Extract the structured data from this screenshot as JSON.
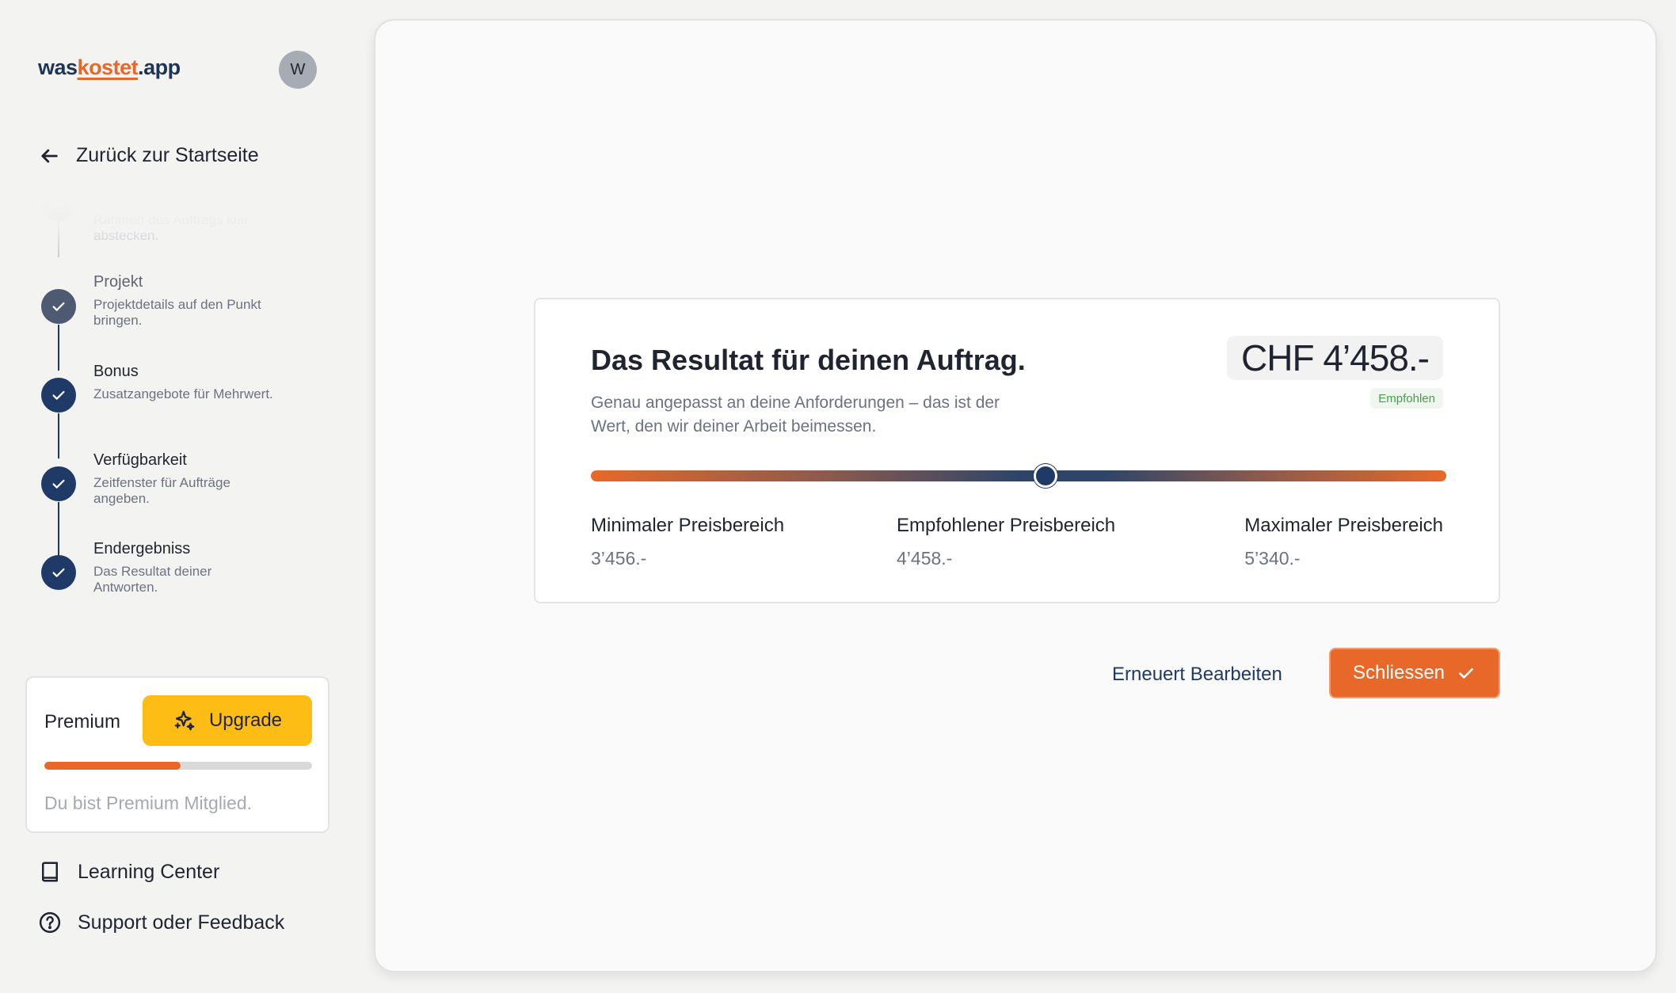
{
  "brand": {
    "prefix": "was",
    "accent": "kostet",
    "suffix": ".app"
  },
  "user": {
    "avatar_initial": "W"
  },
  "nav": {
    "back_label": "Zurück zur Startseite"
  },
  "steps": [
    {
      "title": "",
      "desc": "Rahmen des Auftrags klar abstecken."
    },
    {
      "title": "Projekt",
      "desc": "Projektdetails auf den Punkt bringen."
    },
    {
      "title": "Bonus",
      "desc": "Zusatzangebote für Mehrwert."
    },
    {
      "title": "Verfügbarkeit",
      "desc": "Zeitfenster für Aufträge angeben."
    },
    {
      "title": "Endergebniss",
      "desc": "Das Resultat deiner Antworten."
    }
  ],
  "premium": {
    "label": "Premium",
    "upgrade_label": "Upgrade",
    "progress_percent": 51,
    "note": "Du bist Premium Mitglied."
  },
  "links": {
    "learning_center": "Learning Center",
    "support": "Support oder Feedback"
  },
  "result": {
    "title": "Das Resultat für deinen Auftrag.",
    "subtitle": "Genau angepasst an deine Anforderungen – das ist der Wert, den wir deiner Arbeit beimessen.",
    "price": "CHF 4’458.-",
    "badge": "Empfohlen",
    "range": {
      "min_value": 3456,
      "max_value": 5340,
      "recommended_value": 4458,
      "min_label": "Minimaler Preisbereich",
      "min_display": "3’456.-",
      "rec_label": "Empfohlener Preisbereich",
      "rec_display": "4’458.-",
      "max_label": "Maximaler Preisbereich",
      "max_display": "5’340.-"
    }
  },
  "actions": {
    "edit_label": "Erneuert Bearbeiten",
    "close_label": "Schliessen"
  },
  "colors": {
    "accent_orange": "#e8682a",
    "navy": "#1f3a66",
    "upgrade_yellow": "#fdbd15",
    "recommended_green": "#4c9a52"
  }
}
